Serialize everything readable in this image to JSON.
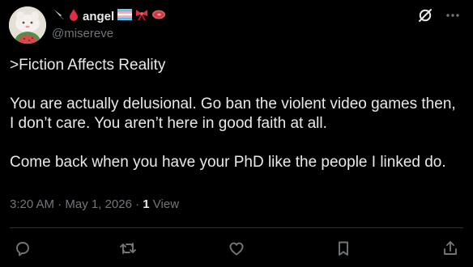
{
  "author": {
    "display_name": "angel",
    "handle": "@misereve",
    "name_emojis": [
      "knife-emoji",
      "blood-drop-emoji"
    ],
    "badge_emojis": [
      "trans-flag-emoji",
      "ribbon-emoji",
      "meat-emoji"
    ]
  },
  "tweet": {
    "paragraphs": [
      ">Fiction Affects Reality",
      "You are actually delusional. Go ban the violent video games then, I don’t care. You aren’t here in good faith at all.",
      "Come back when you have your PhD like the people I linked do."
    ]
  },
  "meta": {
    "time": "3:20 AM",
    "sep1": " · ",
    "date": "May 1, 2026",
    "sep2": " · ",
    "view_count": "1",
    "view_label": " View"
  },
  "icons": {
    "top": [
      "grok-icon",
      "more-icon"
    ],
    "actions": [
      "reply-icon",
      "retweet-icon",
      "like-icon",
      "bookmark-icon",
      "share-icon"
    ]
  },
  "colors": {
    "background": "#000000",
    "text": "#e7e9ea",
    "muted": "#71767b",
    "divider": "#2f3336"
  }
}
